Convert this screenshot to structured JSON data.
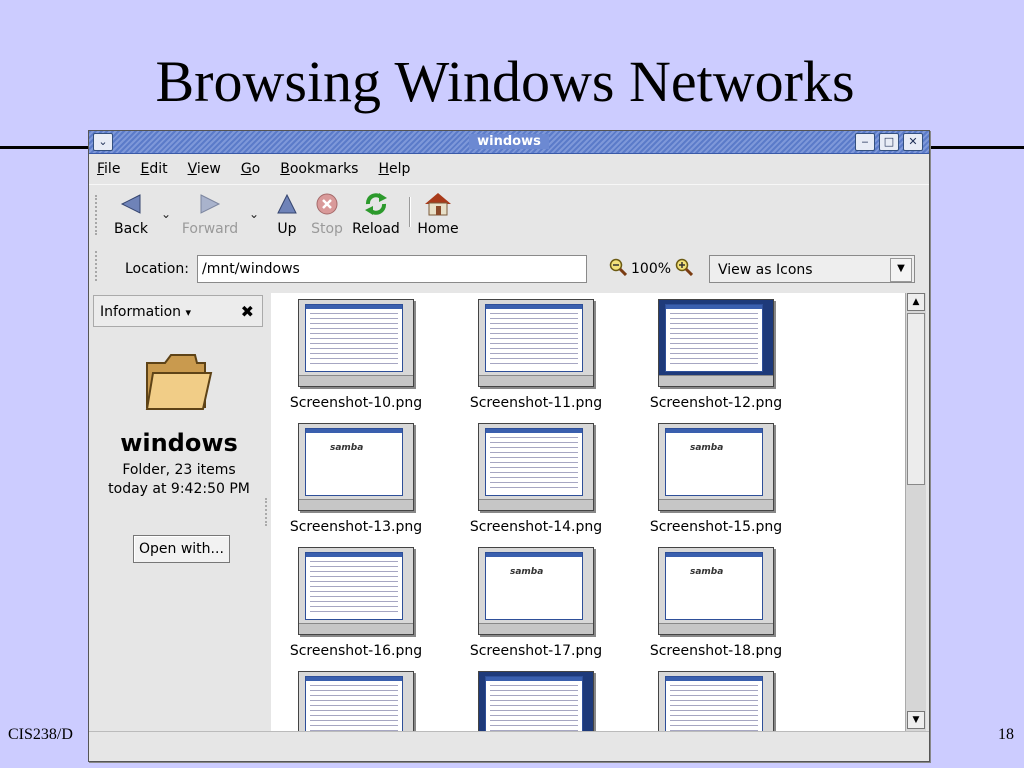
{
  "slide": {
    "title": "Browsing Windows Networks",
    "footer_left": "CIS238/D",
    "page_number": "18"
  },
  "window": {
    "title": "windows",
    "buttons": {
      "menu": "⌄",
      "minimize": "‒",
      "maximize": "□",
      "close": "✕"
    }
  },
  "menu": [
    {
      "accel": "F",
      "rest": "ile"
    },
    {
      "accel": "E",
      "rest": "dit"
    },
    {
      "accel": "V",
      "rest": "iew"
    },
    {
      "accel": "G",
      "rest": "o"
    },
    {
      "accel": "B",
      "rest": "ookmarks"
    },
    {
      "accel": "H",
      "rest": "elp"
    }
  ],
  "toolbar": {
    "back": "Back",
    "forward": "Forward",
    "up": "Up",
    "stop": "Stop",
    "reload": "Reload",
    "home": "Home"
  },
  "location": {
    "label": "Location:",
    "value": "/mnt/windows",
    "zoom": "100%",
    "view_mode": "View as Icons"
  },
  "sidebar": {
    "header": "Information",
    "folder_name": "windows",
    "meta_line1": "Folder, 23 items",
    "meta_line2": "today at 9:42:50 PM",
    "open_with": "Open with..."
  },
  "files": [
    "Screenshot-10.png",
    "Screenshot-11.png",
    "Screenshot-12.png",
    "Screenshot-13.png",
    "Screenshot-14.png",
    "Screenshot-15.png",
    "Screenshot-16.png",
    "Screenshot-17.png",
    "Screenshot-18.png"
  ],
  "thumb_samba_text": "samba",
  "colors": {
    "slide_bg": "#ccccff",
    "titlebar": "#6c89d2",
    "content_bg": "#ffffff"
  }
}
